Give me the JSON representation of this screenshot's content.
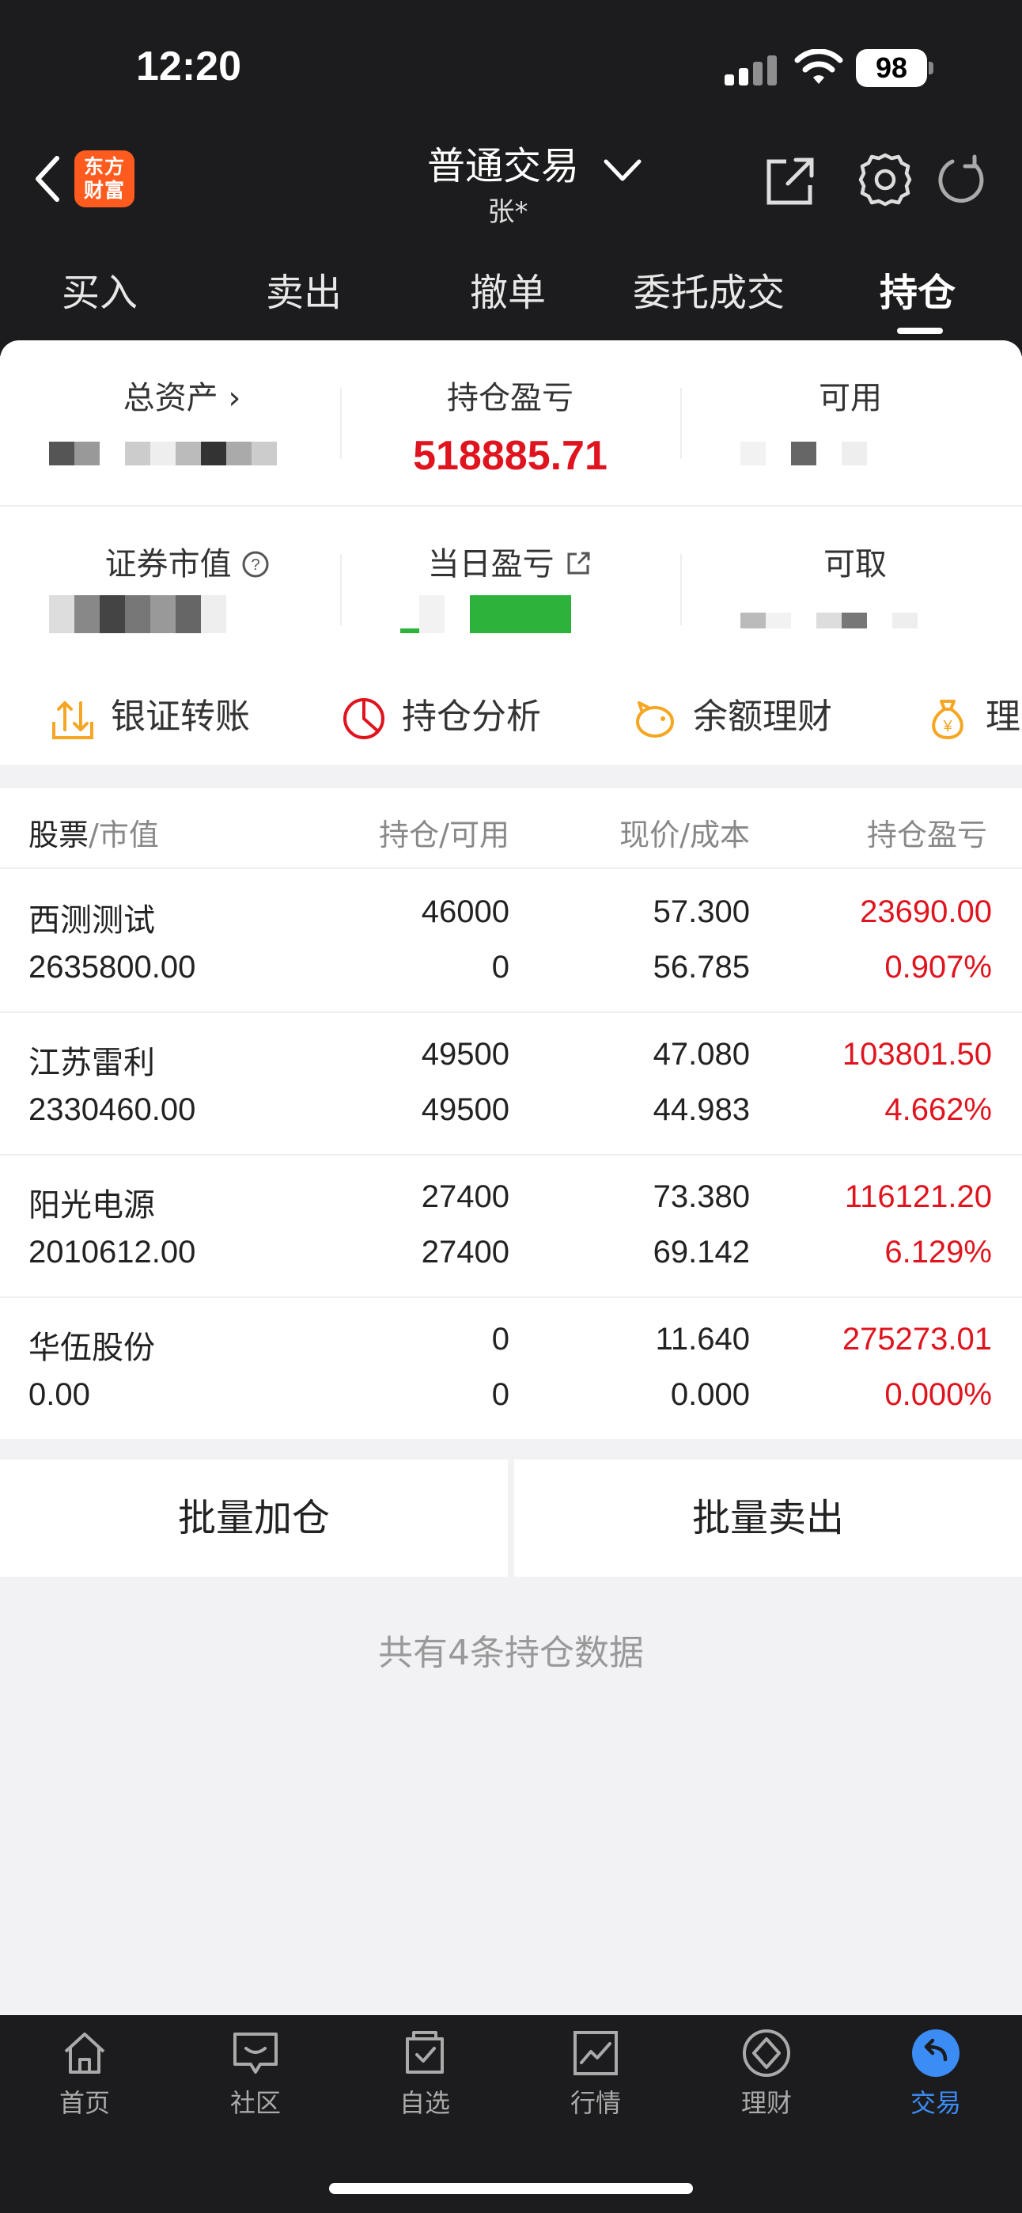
{
  "status": {
    "time": "12:20",
    "battery": "98"
  },
  "header": {
    "logo_text": "东方\n财富",
    "title": "普通交易",
    "user": "张*"
  },
  "tabs": [
    {
      "label": "买入"
    },
    {
      "label": "卖出"
    },
    {
      "label": "撤单"
    },
    {
      "label": "委托成交"
    },
    {
      "label": "持仓",
      "active": true
    }
  ],
  "summary": {
    "total_assets_label": "总资产",
    "position_pl_label": "持仓盈亏",
    "position_pl_value": "518885.71",
    "available_label": "可用",
    "market_value_label": "证券市值",
    "daily_pl_label": "当日盈亏",
    "withdrawable_label": "可取"
  },
  "quick_actions": [
    {
      "label": "银证转账",
      "icon": "transfer-icon"
    },
    {
      "label": "持仓分析",
      "icon": "pie-chart-icon"
    },
    {
      "label": "余额理财",
      "icon": "piggy-bank-icon"
    },
    {
      "label": "理财",
      "icon": "money-bag-icon"
    }
  ],
  "table": {
    "headers": {
      "stock": "股票",
      "market_value": "市值",
      "position": "持仓",
      "available": "可用",
      "price": "现价",
      "cost": "成本",
      "pl": "持仓盈亏"
    },
    "rows": [
      {
        "name": "西测测试",
        "market_value": "2635800.00",
        "position": "46000",
        "available": "0",
        "price": "57.300",
        "cost": "56.785",
        "pl": "23690.00",
        "pl_pct": "0.907%"
      },
      {
        "name": "江苏雷利",
        "market_value": "2330460.00",
        "position": "49500",
        "available": "49500",
        "price": "47.080",
        "cost": "44.983",
        "pl": "103801.50",
        "pl_pct": "4.662%"
      },
      {
        "name": "阳光电源",
        "market_value": "2010612.00",
        "position": "27400",
        "available": "27400",
        "price": "73.380",
        "cost": "69.142",
        "pl": "116121.20",
        "pl_pct": "6.129%"
      },
      {
        "name": "华伍股份",
        "market_value": "0.00",
        "position": "0",
        "available": "0",
        "price": "11.640",
        "cost": "0.000",
        "pl": "275273.01",
        "pl_pct": "0.000%"
      }
    ]
  },
  "batch": {
    "add_label": "批量加仓",
    "sell_label": "批量卖出"
  },
  "footer_note": "共有4条持仓数据",
  "bottom_nav": [
    {
      "label": "首页",
      "icon": "home-icon"
    },
    {
      "label": "社区",
      "icon": "community-icon"
    },
    {
      "label": "自选",
      "icon": "watchlist-icon"
    },
    {
      "label": "行情",
      "icon": "market-icon"
    },
    {
      "label": "理财",
      "icon": "wealth-icon"
    },
    {
      "label": "交易",
      "icon": "trade-icon",
      "active": true
    }
  ],
  "colors": {
    "accent_red": "#e0141e",
    "active_blue": "#3b8cf5",
    "logo_orange": "#ff5b1f",
    "dark_bg": "#1c1c1e"
  }
}
